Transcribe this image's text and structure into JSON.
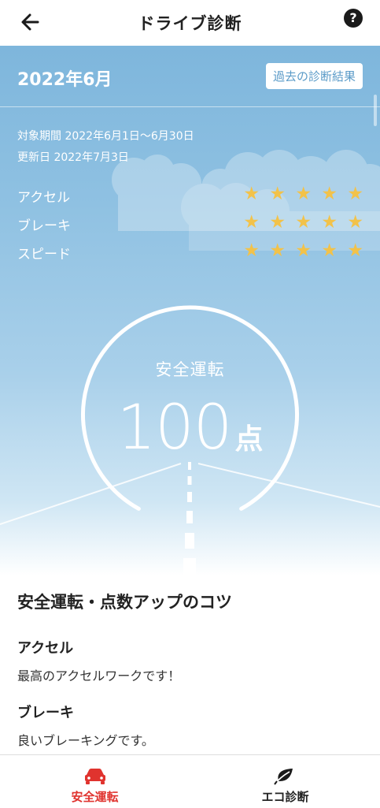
{
  "header": {
    "title": "ドライブ診断",
    "back_icon": "arrow-left-icon",
    "help_icon": "question-icon",
    "help_glyph": "?"
  },
  "summary": {
    "month": "2022年6月",
    "past_results_label": "過去の診断結果",
    "period": "対象期間 2022年6月1日〜6月30日",
    "updated": "更新日 2022年7月3日"
  },
  "ratings": [
    {
      "label": "アクセル",
      "stars": 5,
      "max": 5
    },
    {
      "label": "ブレーキ",
      "stars": 5,
      "max": 5
    },
    {
      "label": "スピード",
      "stars": 5,
      "max": 5
    }
  ],
  "gauge": {
    "label": "安全運転",
    "score": "100",
    "unit": "点",
    "score_value": 100,
    "max": 100
  },
  "tips": {
    "title": "安全運転・点数アップのコツ",
    "items": [
      {
        "heading": "アクセル",
        "body": "最高のアクセルワークです！"
      },
      {
        "heading": "ブレーキ",
        "body": "良いブレーキングです。"
      }
    ]
  },
  "bottom_nav": [
    {
      "label": "安全運転",
      "icon": "car-icon",
      "active": true
    },
    {
      "label": "エコ診断",
      "icon": "leaf-icon",
      "active": false
    }
  ],
  "colors": {
    "accent": "#e0332e",
    "star": "#f2c24a",
    "sky_top": "#7eb6dc",
    "link": "#5b9bc8"
  }
}
